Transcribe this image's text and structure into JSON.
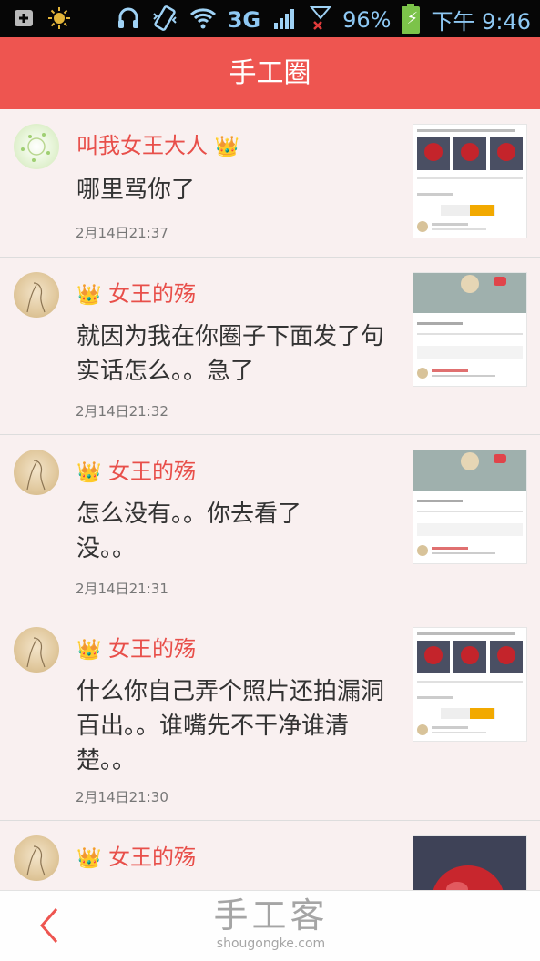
{
  "status_bar": {
    "network": "3G",
    "battery": "96%",
    "time": "下午 9:46"
  },
  "header": {
    "title": "手工圈"
  },
  "items": [
    {
      "name": "叫我女王大人",
      "message": "哪里骂你了",
      "time": "2月14日21:37",
      "thumb": "roses-post"
    },
    {
      "name": "女王的殇",
      "message": "就因为我在你圈子下面发了句实话怎么。。急了",
      "time": "2月14日21:32",
      "thumb": "profile-post"
    },
    {
      "name": "女王的殇",
      "message": "怎么没有。。你去看了没。。",
      "time": "2月14日21:31",
      "thumb": "profile-post"
    },
    {
      "name": "女王的殇",
      "message": "什么你自己弄个照片还拍漏洞百出。。谁嘴先不干净谁清楚。。",
      "time": "2月14日21:30",
      "thumb": "roses-post"
    },
    {
      "name": "女王的殇",
      "message": "",
      "time": "",
      "thumb": "rose-photo"
    }
  ],
  "footer": {
    "watermark_cn": "手工客",
    "watermark_en": "shougongke.com"
  },
  "colors": {
    "accent": "#ee5550",
    "name": "#e84f4a"
  }
}
